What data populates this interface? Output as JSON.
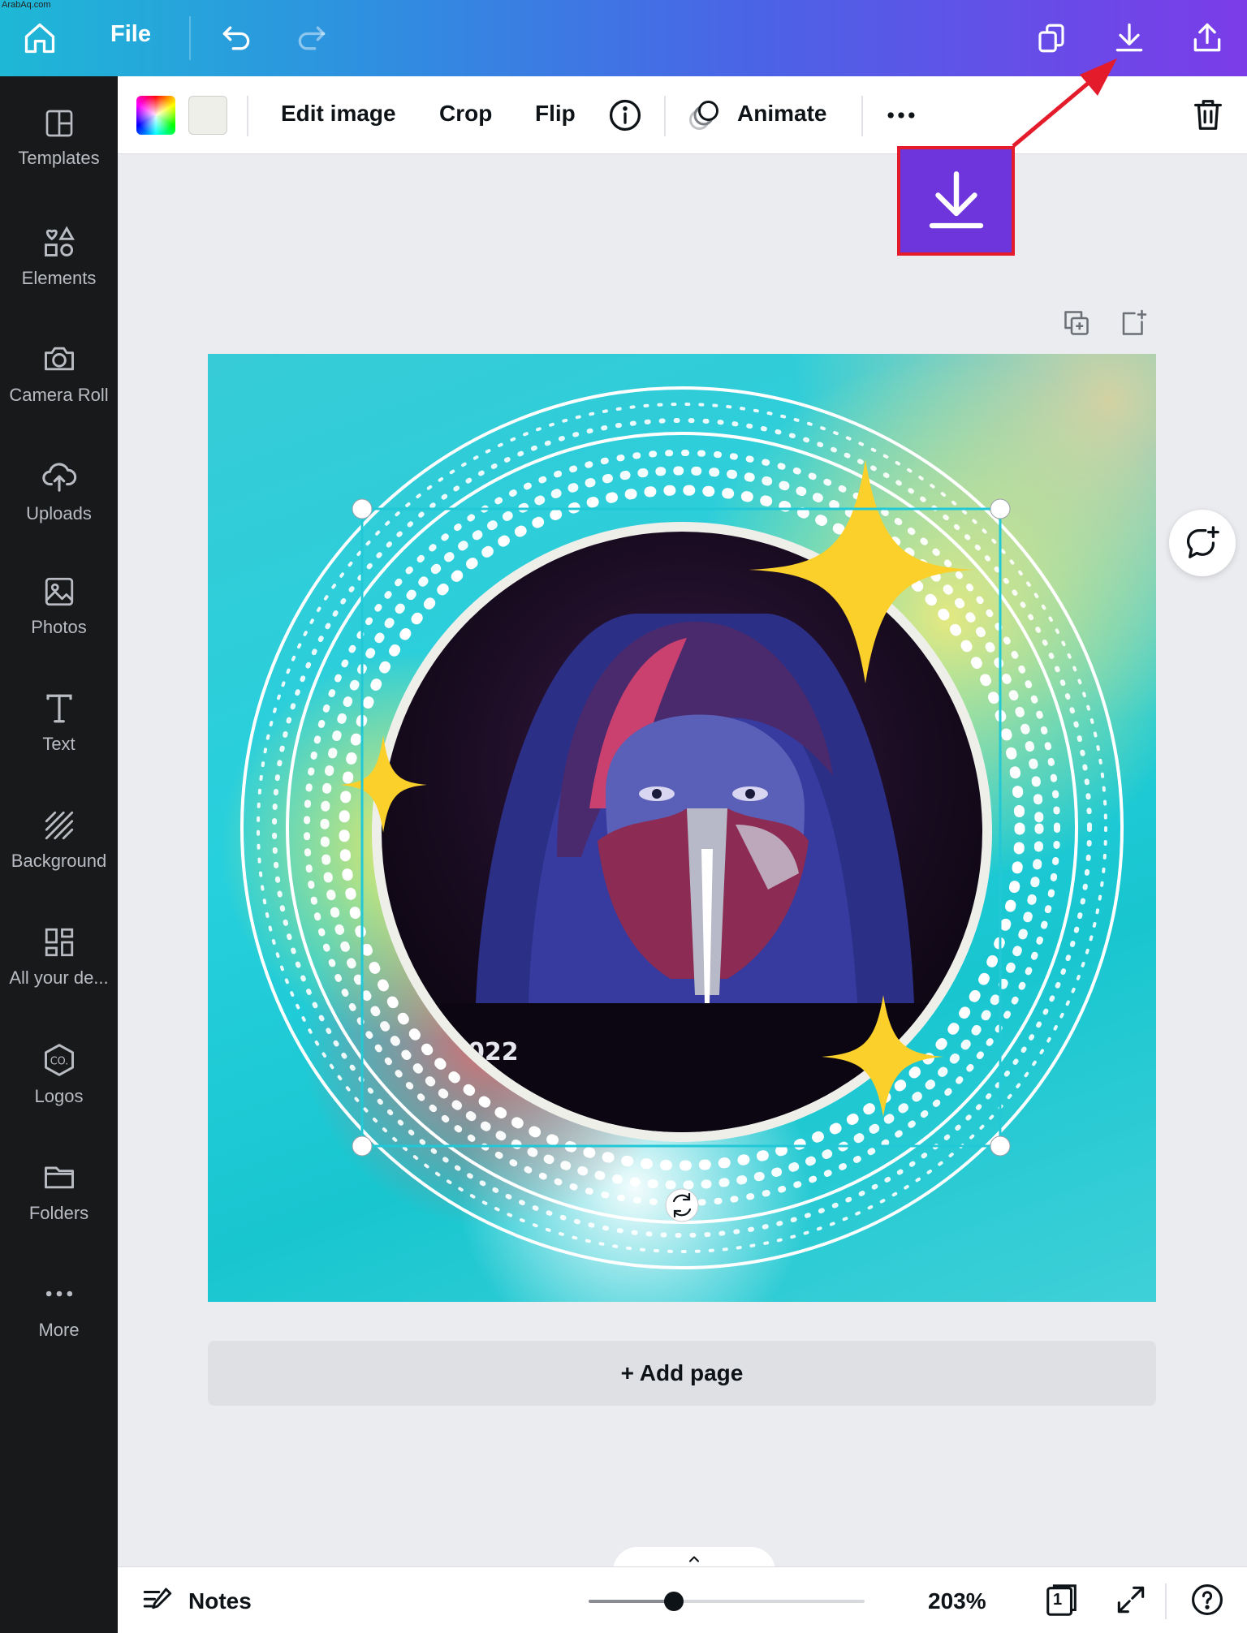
{
  "watermark": "ArabAq.com",
  "topbar": {
    "home_icon": "home-icon",
    "file_label": "File",
    "undo_icon": "undo-icon",
    "redo_icon": "redo-icon",
    "duplicate_icon": "copy-icon",
    "download_icon": "download-icon",
    "share_icon": "share-icon",
    "gradient_start": "#1eb8d6",
    "gradient_end": "#7b3ce8"
  },
  "sidebar": {
    "items": [
      {
        "label": "Templates",
        "icon": "templates-icon"
      },
      {
        "label": "Elements",
        "icon": "elements-icon"
      },
      {
        "label": "Camera Roll",
        "icon": "camera-icon"
      },
      {
        "label": "Uploads",
        "icon": "upload-cloud-icon"
      },
      {
        "label": "Photos",
        "icon": "photo-icon"
      },
      {
        "label": "Text",
        "icon": "text-icon"
      },
      {
        "label": "Background",
        "icon": "background-icon"
      },
      {
        "label": "All your de...",
        "icon": "grid-icon"
      },
      {
        "label": "Logos",
        "icon": "logo-icon"
      },
      {
        "label": "Folders",
        "icon": "folder-icon"
      },
      {
        "label": "More",
        "icon": "more-icon"
      }
    ]
  },
  "toolbar": {
    "edit_image": "Edit image",
    "crop": "Crop",
    "flip": "Flip",
    "animate": "Animate",
    "swatch_color": "#efefea"
  },
  "canvas": {
    "photo_text": "022"
  },
  "add_page": "+ Add page",
  "bottombar": {
    "notes": "Notes",
    "zoom": "203%",
    "zoom_level": 0.31,
    "page_count": "1"
  },
  "colors": {
    "accent": "#6f35dd",
    "highlight": "#e41b2b",
    "selection": "#22c8d6",
    "star": "#fcd02a"
  }
}
